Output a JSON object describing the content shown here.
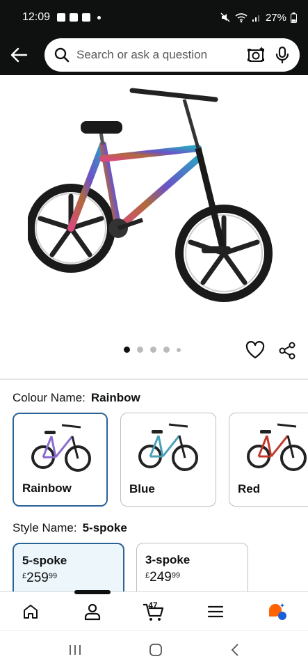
{
  "status_bar": {
    "time": "12:09",
    "battery": "27%"
  },
  "search": {
    "placeholder": "Search or ask a question"
  },
  "image_carousel": {
    "page_count": 5,
    "active_index": 0
  },
  "colour": {
    "label": "Colour Name:",
    "selected": "Rainbow",
    "options": [
      {
        "name": "Rainbow",
        "frame_color": "#8a6bd0"
      },
      {
        "name": "Blue",
        "frame_color": "#4aa0b8"
      },
      {
        "name": "Red",
        "frame_color": "#c0392b"
      }
    ]
  },
  "style": {
    "label": "Style Name:",
    "selected": "5-spoke",
    "options": [
      {
        "name": "5-spoke",
        "currency": "£",
        "whole": "259",
        "fraction": "99"
      },
      {
        "name": "3-spoke",
        "currency": "£",
        "whole": "249",
        "fraction": "99"
      }
    ]
  },
  "bottom_nav": {
    "cart_count": "47"
  },
  "colors": {
    "header_bg": "#0f1111",
    "selected_border": "#2a6395",
    "selected_bg": "#edf6fb",
    "accent_orange": "#ff6200"
  }
}
